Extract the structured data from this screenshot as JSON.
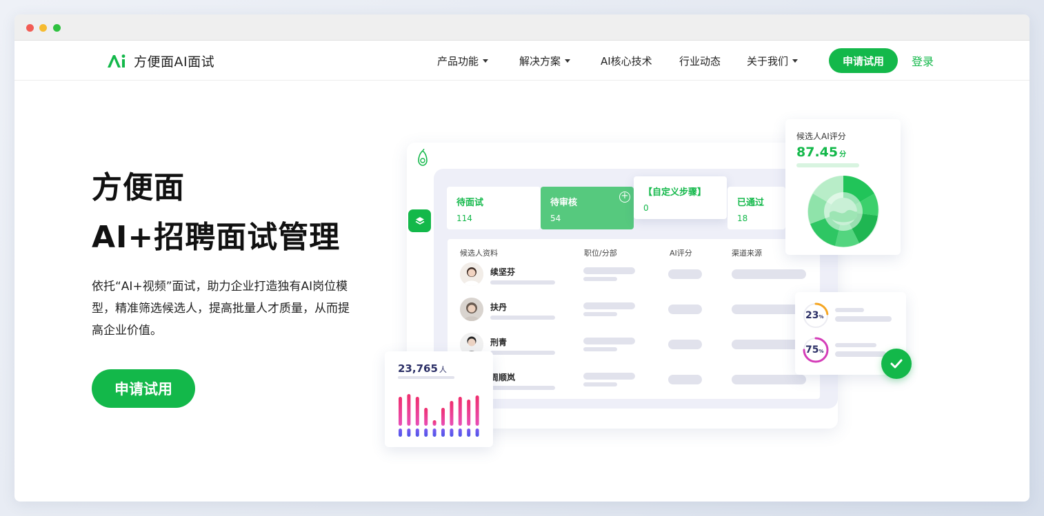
{
  "brand": {
    "name": "方便面AI面试",
    "accent": "#13b84a"
  },
  "nav": {
    "items": [
      {
        "label": "产品功能",
        "dropdown": true
      },
      {
        "label": "解决方案",
        "dropdown": true
      },
      {
        "label": "AI核心技术",
        "dropdown": false
      },
      {
        "label": "行业动态",
        "dropdown": false
      },
      {
        "label": "关于我们",
        "dropdown": true
      }
    ],
    "trial_label": "申请试用",
    "login_label": "登录"
  },
  "hero": {
    "title_line1": "方便面",
    "title_line2": "AI+招聘面试管理",
    "description": "依托“AI+视频”面试，助力企业打造独有AI岗位模型，精准筛选候选人，提高批量人才质量，从而提高企业价值。",
    "cta_label": "申请试用"
  },
  "dashboard": {
    "steps": [
      {
        "label": "待面试",
        "count": "114",
        "active": false
      },
      {
        "label": "待审核",
        "count": "54",
        "active": true
      },
      {
        "label": "【自定义步骤】",
        "count": "0",
        "active": false
      },
      {
        "label": "已通过",
        "count": "18",
        "active": false
      }
    ],
    "table_headers": [
      "候选人资料",
      "职位/分部",
      "AI评分",
      "渠道来源"
    ],
    "candidates": [
      "续坚芬",
      "扶丹",
      "刑青",
      "周顺岚"
    ],
    "score_card": {
      "title": "候选人AI评分",
      "value": "87.45",
      "unit": "分"
    },
    "percent_items": [
      {
        "value": "23",
        "unit": "%",
        "fraction": 0.23,
        "color": "#f5a623"
      },
      {
        "value": "75",
        "unit": "%",
        "fraction": 0.75,
        "color": "#d43cb8"
      }
    ],
    "stat_card": {
      "value": "23,765",
      "unit": "人"
    }
  }
}
